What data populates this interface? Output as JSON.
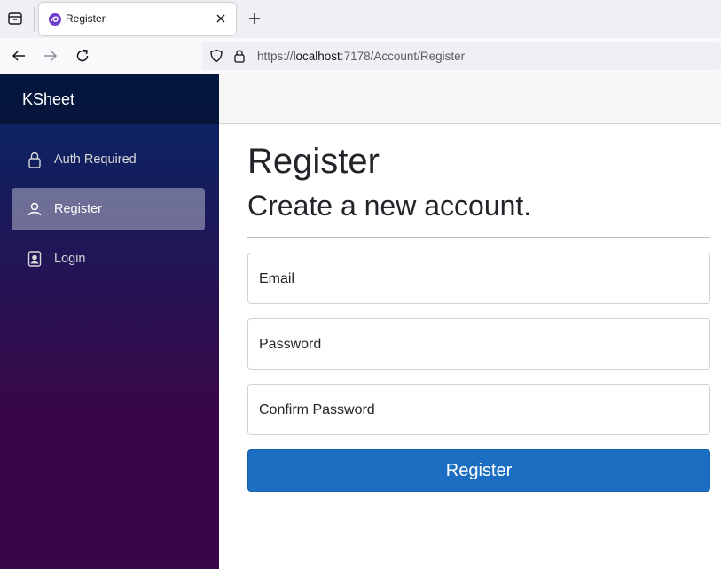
{
  "browser": {
    "tab": {
      "title": "Register",
      "favicon": "blazor-favicon-icon"
    },
    "url": {
      "scheme": "https://",
      "host": "localhost",
      "rest": ":7178/Account/Register"
    },
    "icons": [
      "tab-list-icon",
      "close-icon",
      "plus-icon",
      "back-arrow-icon",
      "forward-arrow-icon",
      "reload-icon",
      "shield-icon",
      "lock-icon"
    ]
  },
  "sidebar": {
    "brand": "KSheet",
    "items": [
      {
        "label": "Auth Required",
        "icon": "lock-icon",
        "active": false
      },
      {
        "label": "Register",
        "icon": "person-icon",
        "active": true
      },
      {
        "label": "Login",
        "icon": "person-badge-icon",
        "active": false
      }
    ]
  },
  "main": {
    "title": "Register",
    "subtitle": "Create a new account.",
    "form": {
      "email_label": "Email",
      "password_label": "Password",
      "confirm_label": "Confirm Password",
      "submit_label": "Register"
    }
  },
  "colors": {
    "sidebar_top": "#052767",
    "sidebar_bottom": "#3a0647",
    "primary": "#1b6ec2",
    "active_item": "rgba(255,255,255,0.37)"
  }
}
